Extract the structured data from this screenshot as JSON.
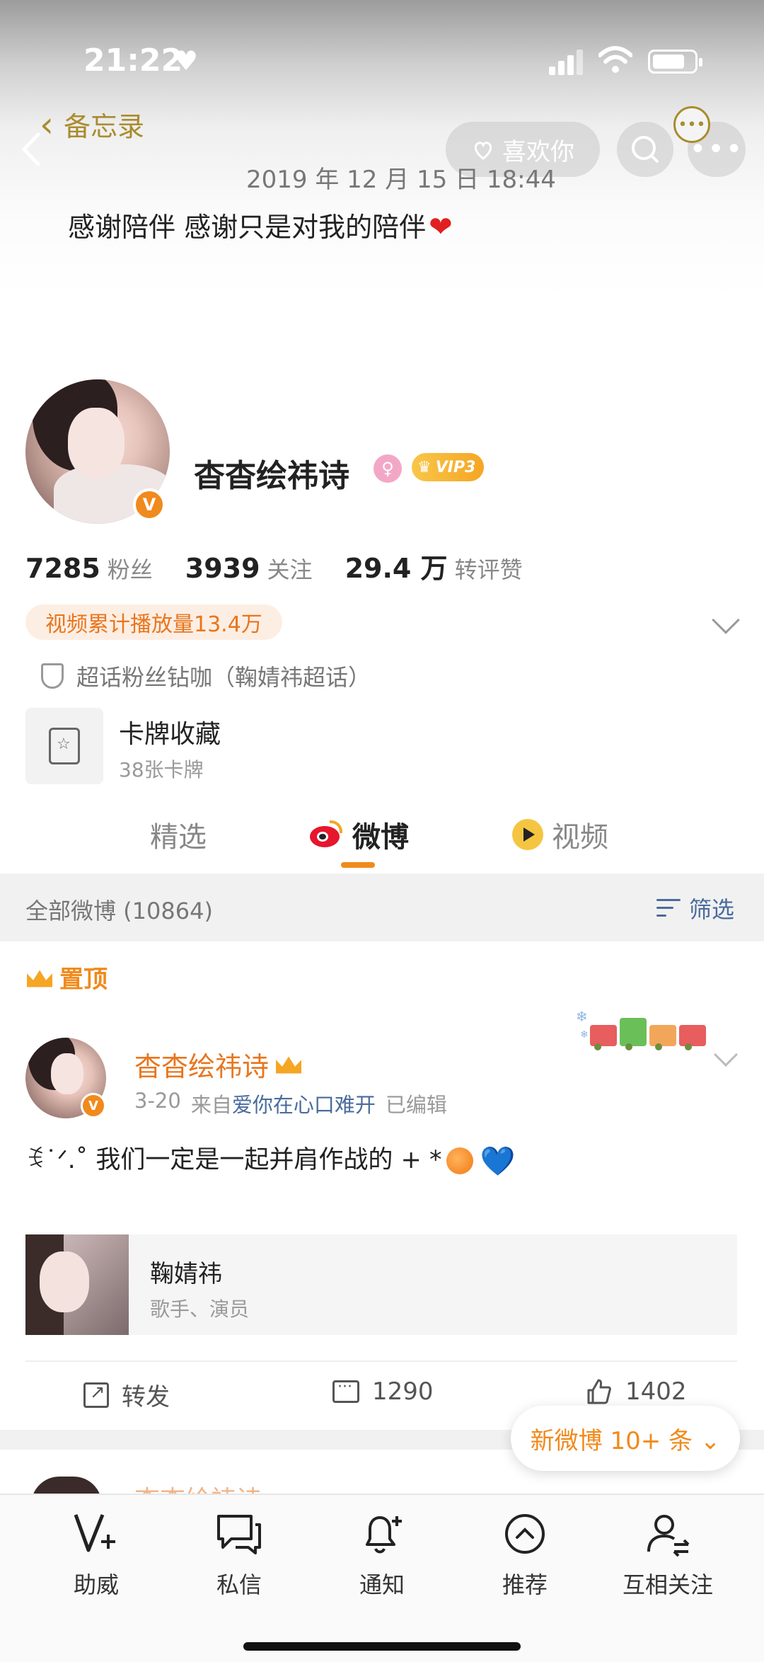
{
  "status_bar": {
    "time": "21:22",
    "heart": "♥"
  },
  "memo": {
    "back_label": "备忘录",
    "date": "2019 年 12 月 15 日 18:44",
    "text": "感谢陪伴 感谢只是对我的陪伴",
    "heart_emoji": "❤"
  },
  "header_actions": {
    "like_label": "喜欢你",
    "more_dots": "•••"
  },
  "profile": {
    "name": "杳杳绘祎诗",
    "vip": "VIP3",
    "verified_mark": "V",
    "stats": [
      {
        "value": "7285",
        "label": "粉丝"
      },
      {
        "value": "3939",
        "label": "关注"
      },
      {
        "value": "29.4 万",
        "label": "转评赞"
      }
    ],
    "video_tag": "视频累计播放量13.4万",
    "supertopic": "超话粉丝钻咖（鞠婧祎超话）",
    "card_title": "卡牌收藏",
    "card_sub": "38张卡牌"
  },
  "tabs": [
    {
      "label": "精选"
    },
    {
      "label": "微博",
      "active": true
    },
    {
      "label": "视频"
    }
  ],
  "filter_bar": {
    "all_label": "全部微博 (10864)",
    "filter_label": "筛选"
  },
  "post": {
    "pinned_label": "置顶",
    "author": "杳杳绘祎诗",
    "date": "3-20",
    "from_prefix": "来自",
    "source": "爱你在心口难开",
    "edited": "已编辑",
    "body": "ꉂ˙ᐟ.˚ 我们一定是一起并肩作战的 + *",
    "blue_heart": "💙",
    "share_title": "鞠婧祎",
    "share_sub": "歌手、演员",
    "actions": {
      "repost": "转发",
      "comments": "1290",
      "likes": "1402"
    }
  },
  "new_weibo_label": "新微博 10+ 条 ⌄",
  "next_post_author": "杳杳绘祎诗",
  "bottom_nav": [
    {
      "label": "助威",
      "icon": "v-plus-icon"
    },
    {
      "label": "私信",
      "icon": "chat-icon"
    },
    {
      "label": "通知",
      "icon": "bell-icon"
    },
    {
      "label": "推荐",
      "icon": "up-circle-icon"
    },
    {
      "label": "互相关注",
      "icon": "mutual-follow-icon"
    }
  ],
  "colors": {
    "accent": "#f08a1c",
    "link": "#4a6b9c",
    "memo_gold": "#a98c2e"
  }
}
